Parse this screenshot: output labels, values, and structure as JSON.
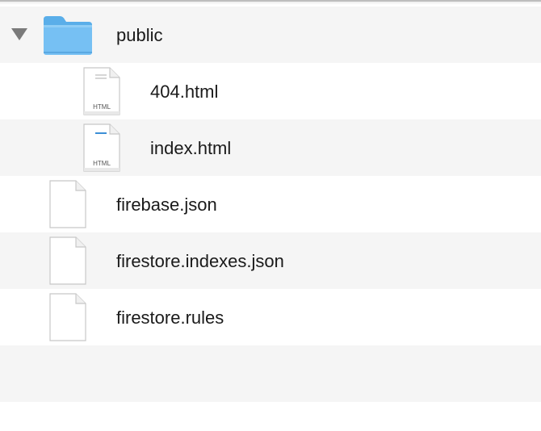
{
  "file_list": {
    "rows": [
      {
        "name": "public",
        "kind": "folder",
        "expanded": true,
        "level": 0,
        "icon": "folder-icon"
      },
      {
        "name": "404.html",
        "kind": "html-file",
        "level": 1,
        "icon": "html-document-icon",
        "badge": "HTML"
      },
      {
        "name": "index.html",
        "kind": "html-file",
        "level": 1,
        "icon": "html-document-icon",
        "badge": "HTML"
      },
      {
        "name": "firebase.json",
        "kind": "file",
        "level": 0,
        "icon": "document-icon"
      },
      {
        "name": "firestore.indexes.json",
        "kind": "file",
        "level": 0,
        "icon": "document-icon"
      },
      {
        "name": "firestore.rules",
        "kind": "file",
        "level": 0,
        "icon": "document-icon"
      }
    ]
  },
  "colors": {
    "row_alt": "#f5f5f5",
    "row_white": "#ffffff",
    "folder_blue": "#6ab7f0",
    "disclosure": "#7a7a7a"
  }
}
